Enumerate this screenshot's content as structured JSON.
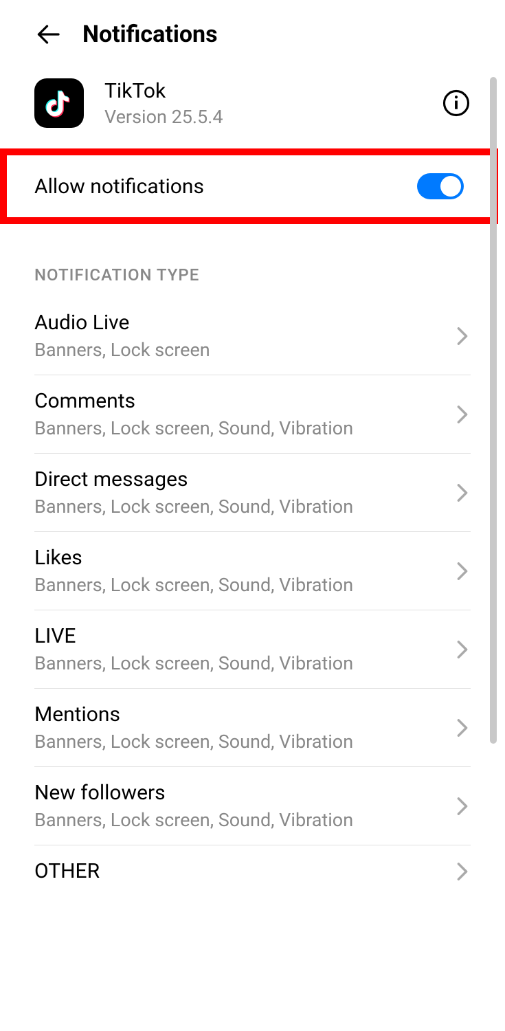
{
  "header": {
    "title": "Notifications"
  },
  "app": {
    "name": "TikTok",
    "version": "Version 25.5.4"
  },
  "allow_notifications": {
    "label": "Allow notifications",
    "enabled": true
  },
  "section_header": "NOTIFICATION TYPE",
  "notification_types": [
    {
      "title": "Audio Live",
      "subtitle": "Banners, Lock screen"
    },
    {
      "title": "Comments",
      "subtitle": "Banners, Lock screen, Sound, Vibration"
    },
    {
      "title": "Direct messages",
      "subtitle": "Banners, Lock screen, Sound, Vibration"
    },
    {
      "title": "Likes",
      "subtitle": "Banners, Lock screen, Sound, Vibration"
    },
    {
      "title": "LIVE",
      "subtitle": "Banners, Lock screen, Sound, Vibration"
    },
    {
      "title": "Mentions",
      "subtitle": "Banners, Lock screen, Sound, Vibration"
    },
    {
      "title": "New followers",
      "subtitle": "Banners, Lock screen, Sound, Vibration"
    },
    {
      "title": "OTHER",
      "subtitle": ""
    }
  ]
}
